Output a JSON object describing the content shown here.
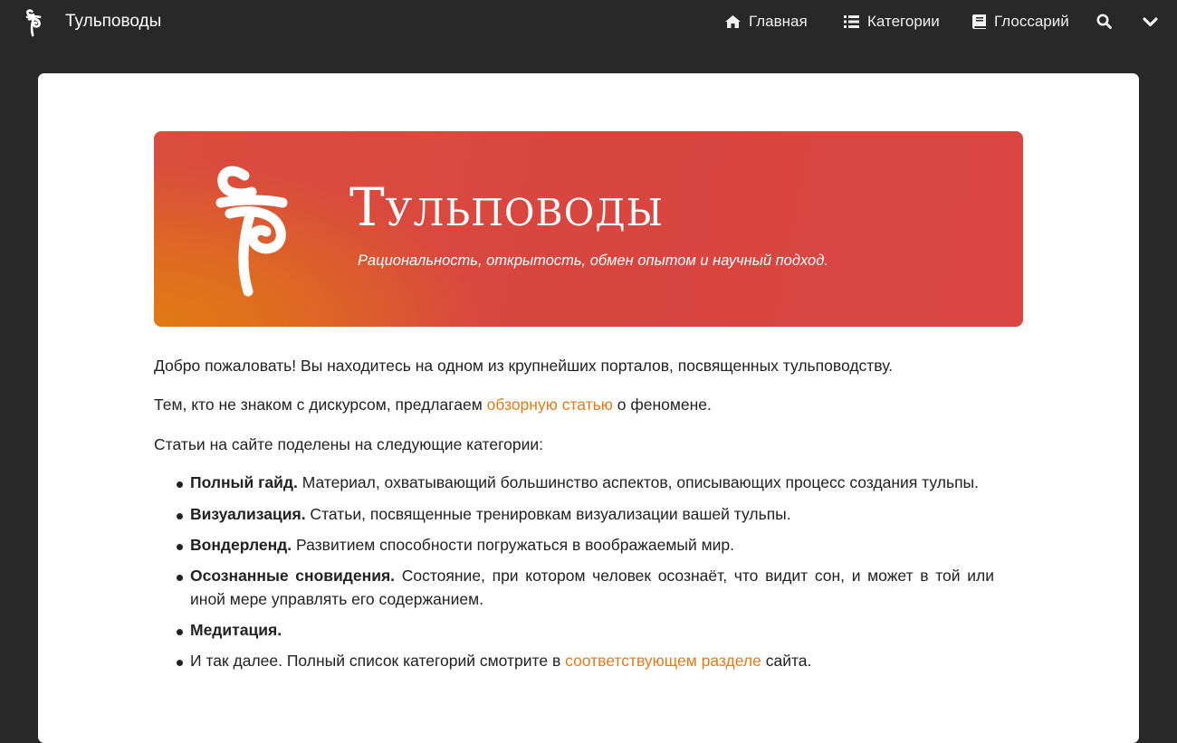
{
  "navbar": {
    "brand": "Тульповоды",
    "items": [
      {
        "label": "Главная",
        "icon": "home-icon"
      },
      {
        "label": "Категории",
        "icon": "list-icon"
      },
      {
        "label": "Глоссарий",
        "icon": "book-icon"
      }
    ],
    "search_icon": "search-icon",
    "menu_icon": "chevron-down-icon"
  },
  "hero": {
    "title": "Тульповоды",
    "subtitle": "Рациональность, открытость, обмен опытом и научный подход."
  },
  "intro": {
    "welcome": "Добро пожаловать! Вы находитесь на одном из крупнейших порталов, посвященных тульповодству.",
    "overview_before": "Тем, кто не знаком с дискурсом, предлагаем ",
    "overview_link": "обзорную статью",
    "overview_after": " о феномене.",
    "categories_intro": "Статьи на сайте поделены на следующие категории:"
  },
  "categories": [
    {
      "name": "Полный гайд.",
      "desc": " Материал, охватывающий большинство аспектов, описывающих процесс создания тульпы."
    },
    {
      "name": "Визуализация.",
      "desc": " Статьи, посвященные тренировкам визуализации вашей тульпы."
    },
    {
      "name": "Вондерленд.",
      "desc": " Развитием способности погружаться в воображаемый мир."
    },
    {
      "name": "Осознанные сновидения.",
      "desc": " Состояние, при котором человек осознаёт, что видит сон, и может в той или иной мере управлять его содержанием."
    },
    {
      "name": "Медитация.",
      "desc": ""
    }
  ],
  "categories_footer": {
    "before": "И так далее. Полный список категорий смотрите в ",
    "link": "соответствующем разделе",
    "after": " сайта."
  },
  "colors": {
    "navbar_bg": "#282828",
    "hero_red": "#d9453f",
    "hero_orange": "#e07a14",
    "link": "#e07b1a"
  }
}
